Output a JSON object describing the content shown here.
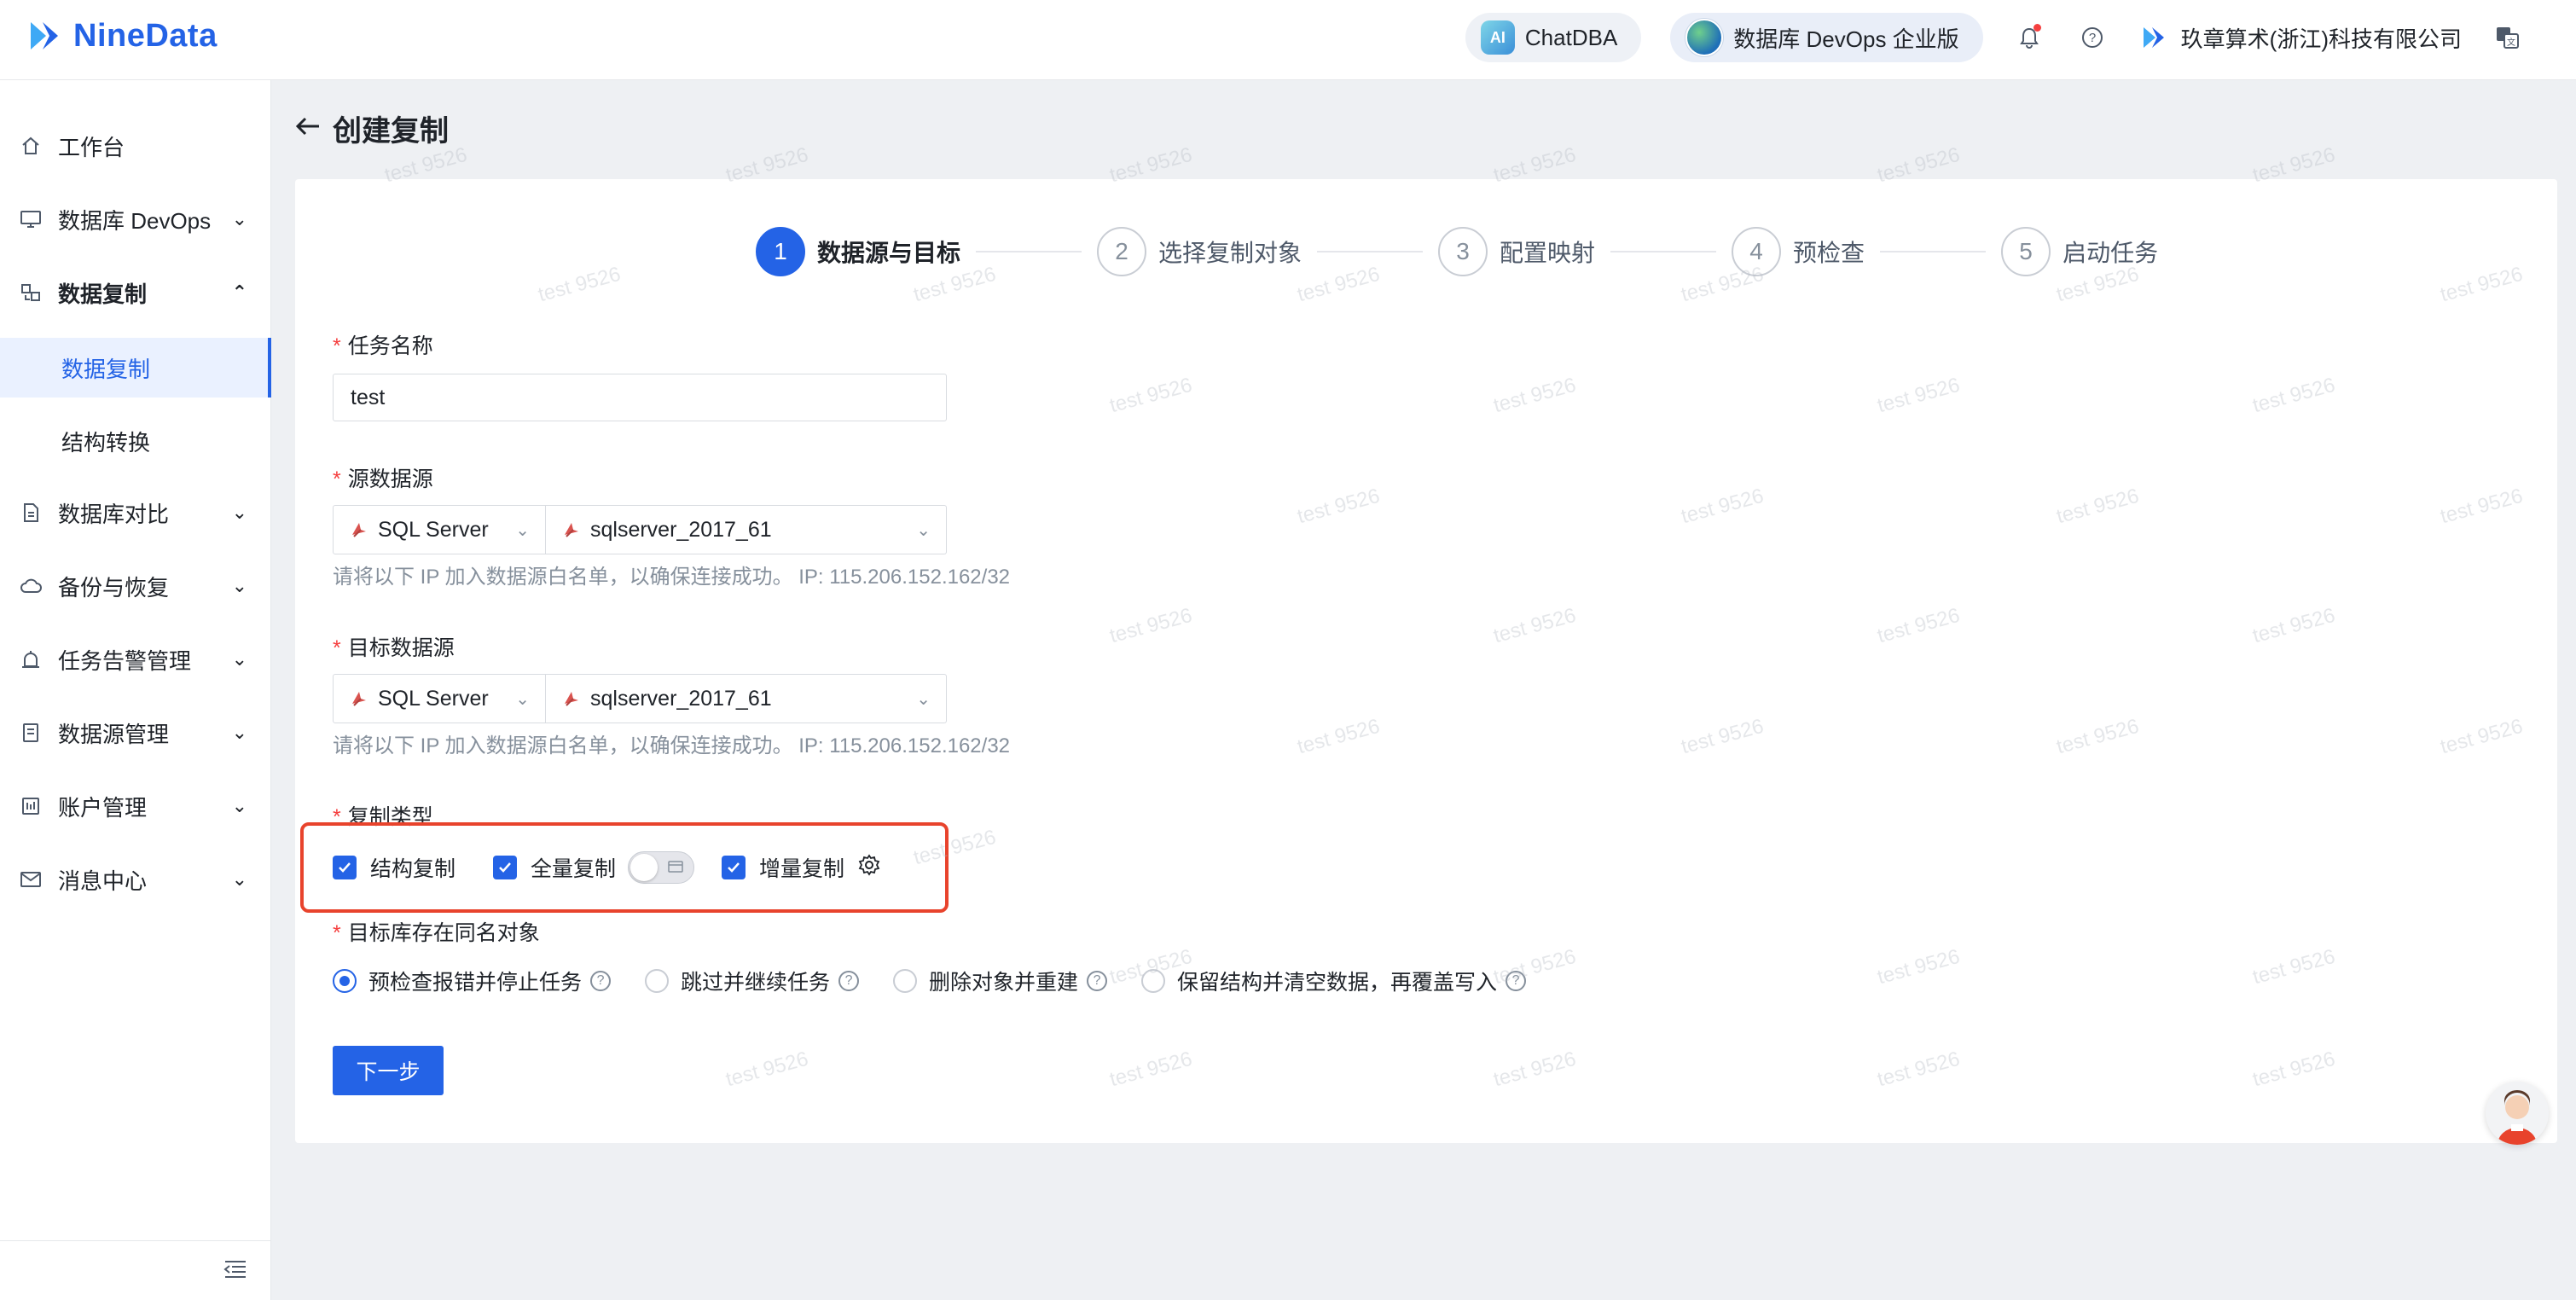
{
  "brand": {
    "name": "NineData"
  },
  "topbar": {
    "chatdba_badge": "AI",
    "chatdba_label": "ChatDBA",
    "devops_label": "数据库 DevOps 企业版",
    "company_name": "玖章算术(浙江)科技有限公司"
  },
  "sidebar": {
    "items": [
      {
        "label": "工作台",
        "icon": "home-icon"
      },
      {
        "label": "数据库 DevOps",
        "icon": "monitor-icon",
        "expandable": true
      },
      {
        "label": "数据复制",
        "icon": "replicate-icon",
        "expanded": true
      },
      {
        "label": "数据库对比",
        "icon": "compare-icon",
        "expandable": true
      },
      {
        "label": "备份与恢复",
        "icon": "cloud-backup-icon",
        "expandable": true
      },
      {
        "label": "任务告警管理",
        "icon": "alarm-icon",
        "expandable": true
      },
      {
        "label": "数据源管理",
        "icon": "datasource-icon",
        "expandable": true
      },
      {
        "label": "账户管理",
        "icon": "account-icon",
        "expandable": true
      },
      {
        "label": "消息中心",
        "icon": "mail-icon",
        "expandable": true
      }
    ],
    "sub_items": [
      {
        "label": "数据复制",
        "active": true
      },
      {
        "label": "结构转换",
        "active": false
      }
    ]
  },
  "page": {
    "title": "创建复制"
  },
  "steps": [
    {
      "num": "1",
      "label": "数据源与目标",
      "active": true
    },
    {
      "num": "2",
      "label": "选择复制对象",
      "active": false
    },
    {
      "num": "3",
      "label": "配置映射",
      "active": false
    },
    {
      "num": "4",
      "label": "预检查",
      "active": false
    },
    {
      "num": "5",
      "label": "启动任务",
      "active": false
    }
  ],
  "form": {
    "task_name_label": "任务名称",
    "task_name_value": "test",
    "source_label": "源数据源",
    "source_type": "SQL Server",
    "source_instance": "sqlserver_2017_61",
    "source_hint": "请将以下 IP 加入数据源白名单，以确保连接成功。 IP: 115.206.152.162/32",
    "target_label": "目标数据源",
    "target_type": "SQL Server",
    "target_instance": "sqlserver_2017_61",
    "target_hint": "请将以下 IP 加入数据源白名单，以确保连接成功。 IP: 115.206.152.162/32",
    "replication_type_label": "复制类型",
    "replication_options": [
      {
        "label": "结构复制",
        "checked": true
      },
      {
        "label": "全量复制",
        "checked": true
      },
      {
        "label": "增量复制",
        "checked": true
      }
    ],
    "full_copy_toggle_on": false,
    "same_name_label": "目标库存在同名对象",
    "same_name_options": [
      {
        "label": "预检查报错并停止任务",
        "selected": true
      },
      {
        "label": "跳过并继续任务",
        "selected": false
      },
      {
        "label": "删除对象并重建",
        "selected": false
      },
      {
        "label": "保留结构并清空数据，再覆盖写入",
        "selected": false
      }
    ],
    "next_button": "下一步"
  },
  "watermark": "test 9526",
  "colors": {
    "primary": "#2463e6",
    "highlight": "#e8432c",
    "required": "#f53f3f"
  }
}
